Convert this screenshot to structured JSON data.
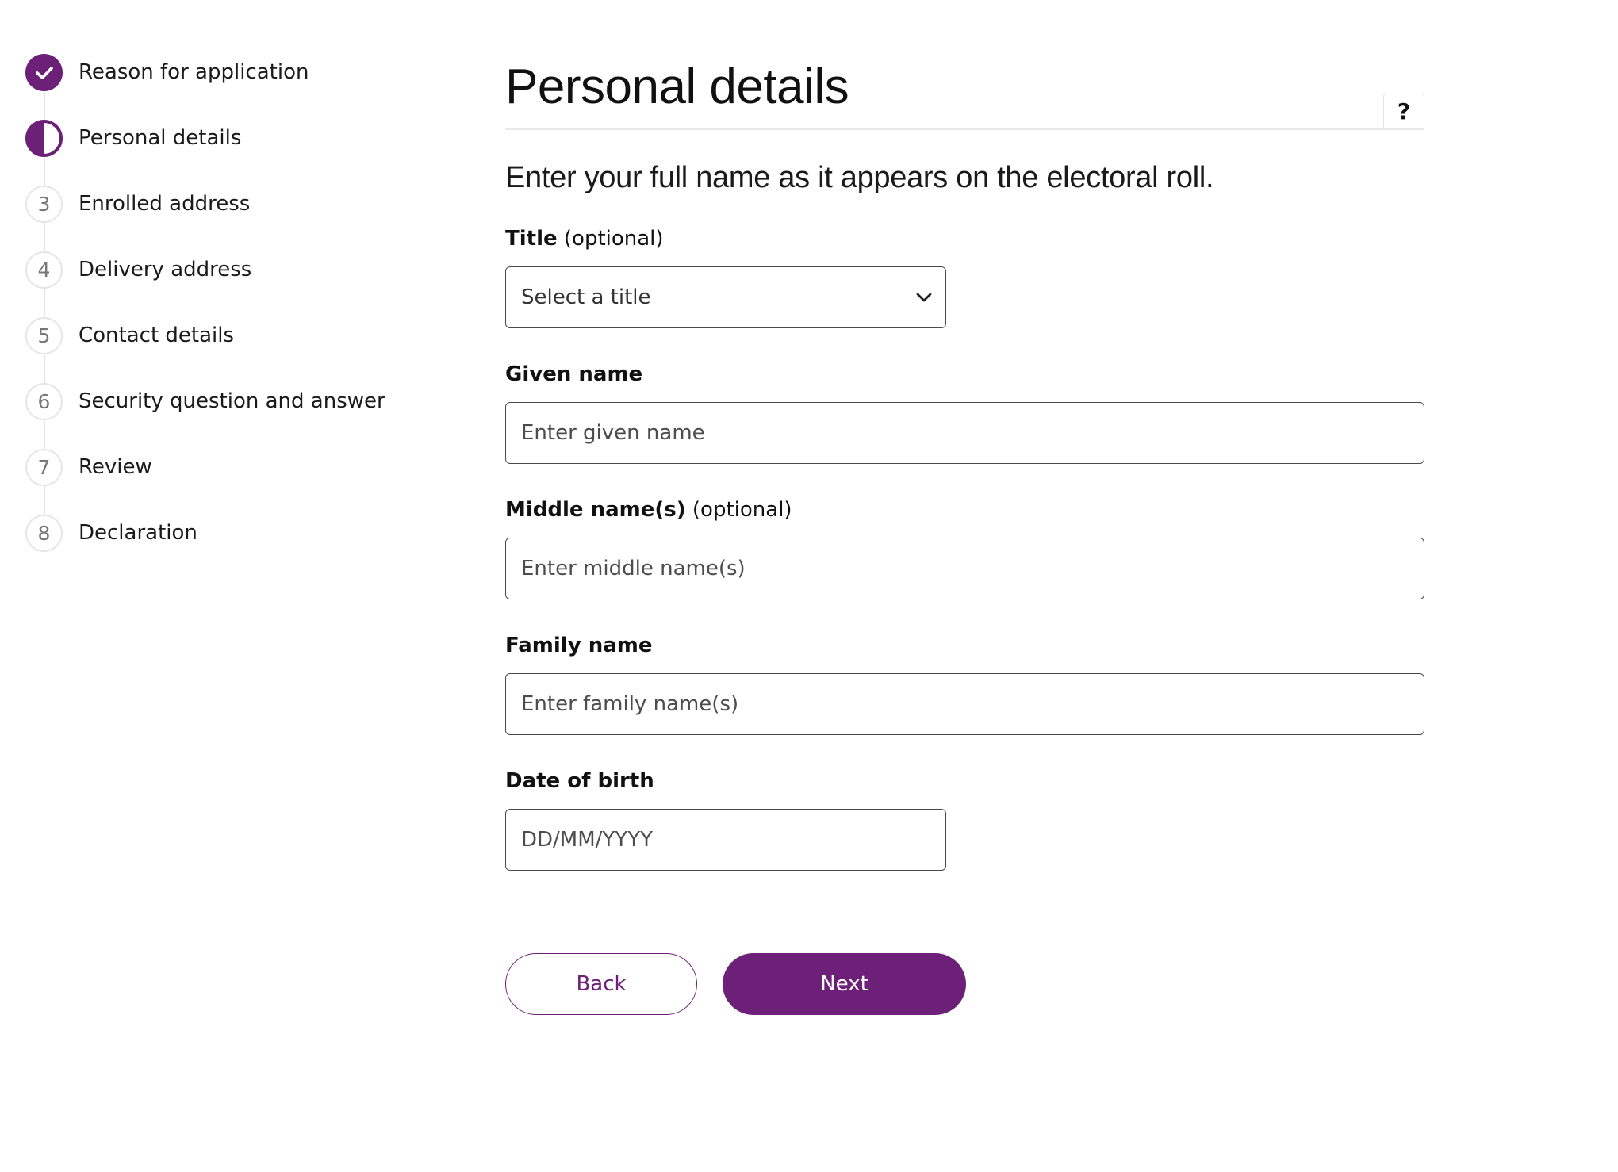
{
  "colors": {
    "brand": "#6d2077",
    "text": "#1a1a1a",
    "border": "#4a4a4a",
    "divider": "#e8e8e8"
  },
  "stepper": {
    "steps": [
      {
        "number": "1",
        "label": "Reason for application",
        "status": "complete",
        "icon": "check-icon"
      },
      {
        "number": "2",
        "label": "Personal details",
        "status": "current",
        "icon": "half-circle-icon"
      },
      {
        "number": "3",
        "label": "Enrolled address",
        "status": "pending"
      },
      {
        "number": "4",
        "label": "Delivery address",
        "status": "pending"
      },
      {
        "number": "5",
        "label": "Contact details",
        "status": "pending"
      },
      {
        "number": "6",
        "label": "Security question and answer",
        "status": "pending"
      },
      {
        "number": "7",
        "label": "Review",
        "status": "pending"
      },
      {
        "number": "8",
        "label": "Declaration",
        "status": "pending"
      }
    ]
  },
  "header": {
    "title": "Personal details",
    "help_label": "?"
  },
  "intro": "Enter your full name as it appears on the electoral roll.",
  "form": {
    "title": {
      "label": "Title",
      "optional": "(optional)",
      "selected": "Select a title"
    },
    "given_name": {
      "label": "Given name",
      "placeholder": "Enter given name"
    },
    "middle_names": {
      "label": "Middle name(s)",
      "optional": "(optional)",
      "placeholder": "Enter middle name(s)"
    },
    "family_name": {
      "label": "Family name",
      "placeholder": "Enter family name(s)"
    },
    "dob": {
      "label": "Date of birth",
      "placeholder": "DD/MM/YYYY"
    }
  },
  "actions": {
    "back_label": "Back",
    "next_label": "Next"
  }
}
